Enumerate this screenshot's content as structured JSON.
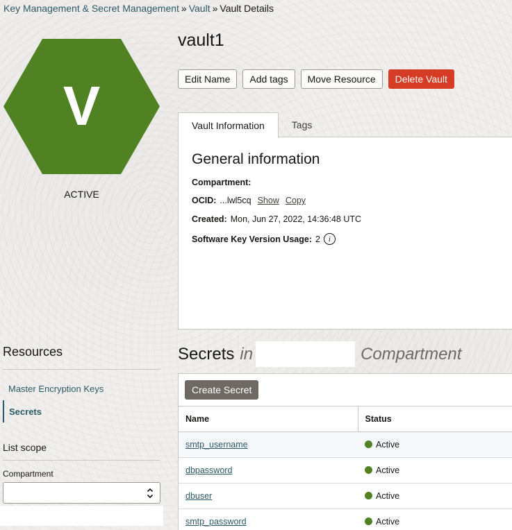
{
  "breadcrumb": {
    "items": [
      {
        "label": "Key Management & Secret Management",
        "link": true
      },
      {
        "label": "Vault",
        "link": true
      },
      {
        "label": "Vault Details",
        "link": false
      }
    ],
    "separator": "»"
  },
  "vault": {
    "icon_letter": "V",
    "status": "ACTIVE",
    "name": "vault1",
    "hex_color": "#508223"
  },
  "actions": {
    "edit_name": "Edit Name",
    "add_tags": "Add tags",
    "move_resource": "Move Resource",
    "delete_vault": "Delete Vault"
  },
  "tabs": [
    {
      "label": "Vault Information",
      "active": true
    },
    {
      "label": "Tags",
      "active": false
    }
  ],
  "general_info": {
    "heading": "General information",
    "compartment_label": "Compartment:",
    "ocid_label": "OCID:",
    "ocid_value": "...lwl5cq",
    "show_link": "Show",
    "copy_link": "Copy",
    "created_label": "Created:",
    "created_value": "Mon, Jun 27, 2022, 14:36:48 UTC",
    "usage_label": "Software Key Version Usage:",
    "usage_value": "2",
    "info_icon": "info-circle-icon"
  },
  "resources": {
    "title": "Resources",
    "items": [
      {
        "label": "Master Encryption Keys",
        "active": false
      },
      {
        "label": "Secrets",
        "active": true
      }
    ]
  },
  "list_scope": {
    "title": "List scope",
    "compartment_label": "Compartment",
    "chevron_icon": "chevron-up-down-icon"
  },
  "secrets": {
    "title_prefix": "Secrets",
    "title_in": "in",
    "title_suffix": "Compartment",
    "create_button": "Create Secret",
    "columns": [
      "Name",
      "Status"
    ],
    "rows": [
      {
        "name": "smtp_username",
        "status": "Active"
      },
      {
        "name": "dbpassword",
        "status": "Active"
      },
      {
        "name": "dbuser",
        "status": "Active"
      },
      {
        "name": "smtp_password",
        "status": "Active"
      }
    ],
    "status_color": "#508223"
  }
}
